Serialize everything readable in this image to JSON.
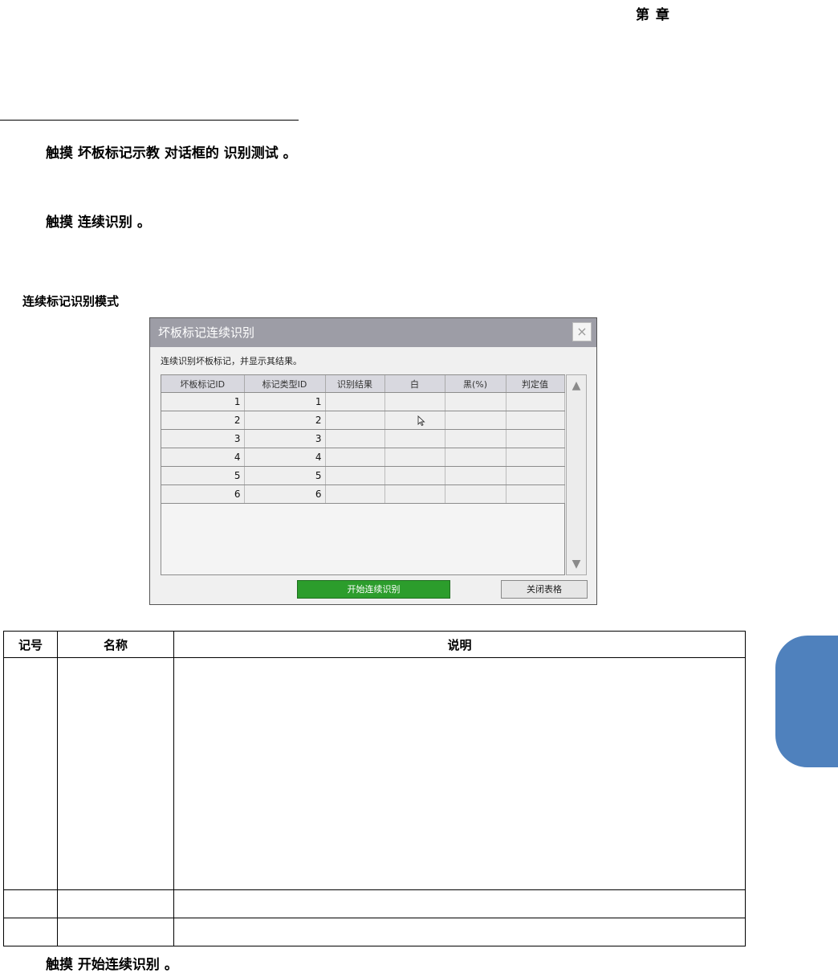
{
  "header": {
    "chapter": "第 章"
  },
  "steps": [
    "触摸 坏板标记示教 对话框的 识别测试 。",
    "触摸 连续识别 。",
    "触摸 开始连续识别 。"
  ],
  "caption": "连续标记识别模式",
  "dialog": {
    "title": "坏板标记连续识别",
    "close": "×",
    "description": "连续识别坏板标记，并显示其结果。",
    "columns": [
      "坏板标记ID",
      "标记类型ID",
      "识别结果",
      "白",
      "黑(%)",
      "判定值"
    ],
    "rows": [
      [
        "1",
        "1",
        "",
        "",
        "",
        ""
      ],
      [
        "2",
        "2",
        "",
        "",
        "",
        ""
      ],
      [
        "3",
        "3",
        "",
        "",
        "",
        ""
      ],
      [
        "4",
        "4",
        "",
        "",
        "",
        ""
      ],
      [
        "5",
        "5",
        "",
        "",
        "",
        ""
      ],
      [
        "6",
        "6",
        "",
        "",
        "",
        ""
      ]
    ],
    "start_button": "开始连续识别",
    "close_button": "关闭表格"
  },
  "desc_table": {
    "headers": [
      "记号",
      "名称",
      "说明"
    ]
  },
  "colors": {
    "side_tab": "#4f81bd",
    "start_button": "#2c9d2c",
    "title_bar": "#9d9da6"
  }
}
